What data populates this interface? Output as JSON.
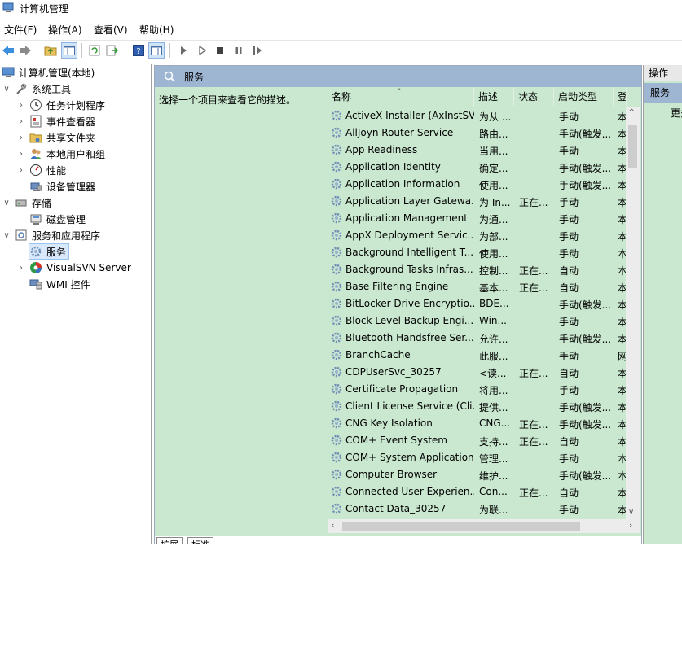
{
  "window": {
    "title": "计算机管理"
  },
  "menu": [
    "文件(F)",
    "操作(A)",
    "查看(V)",
    "帮助(H)"
  ],
  "tree": {
    "root": "计算机管理(本地)",
    "system_tools": "系统工具",
    "task_scheduler": "任务计划程序",
    "event_viewer": "事件查看器",
    "shared_folders": "共享文件夹",
    "local_users": "本地用户和组",
    "performance": "性能",
    "device_manager": "设备管理器",
    "storage": "存储",
    "disk_management": "磁盘管理",
    "services_apps": "服务和应用程序",
    "services": "服务",
    "visualsvn": "VisualSVN Server",
    "wmi": "WMI 控件"
  },
  "center": {
    "header": "服务",
    "description": "选择一个项目来查看它的描述。",
    "columns": {
      "name": "名称",
      "desc": "描述",
      "status": "状态",
      "startup": "启动类型",
      "logon": "登"
    },
    "rows": [
      {
        "name": "ActiveX Installer (AxInstSV)",
        "desc": "为从 ...",
        "status": "",
        "startup": "手动",
        "logon": "本"
      },
      {
        "name": "AllJoyn Router Service",
        "desc": "路由...",
        "status": "",
        "startup": "手动(触发...",
        "logon": "本"
      },
      {
        "name": "App Readiness",
        "desc": "当用...",
        "status": "",
        "startup": "手动",
        "logon": "本"
      },
      {
        "name": "Application Identity",
        "desc": "确定...",
        "status": "",
        "startup": "手动(触发...",
        "logon": "本"
      },
      {
        "name": "Application Information",
        "desc": "使用...",
        "status": "",
        "startup": "手动(触发...",
        "logon": "本"
      },
      {
        "name": "Application Layer Gatewa...",
        "desc": "为 In...",
        "status": "正在...",
        "startup": "手动",
        "logon": "本"
      },
      {
        "name": "Application Management",
        "desc": "为通...",
        "status": "",
        "startup": "手动",
        "logon": "本"
      },
      {
        "name": "AppX Deployment Servic...",
        "desc": "为部...",
        "status": "",
        "startup": "手动",
        "logon": "本"
      },
      {
        "name": "Background Intelligent T...",
        "desc": "使用...",
        "status": "",
        "startup": "手动",
        "logon": "本"
      },
      {
        "name": "Background Tasks Infras...",
        "desc": "控制...",
        "status": "正在...",
        "startup": "自动",
        "logon": "本"
      },
      {
        "name": "Base Filtering Engine",
        "desc": "基本...",
        "status": "正在...",
        "startup": "自动",
        "logon": "本"
      },
      {
        "name": "BitLocker Drive Encryptio...",
        "desc": "BDE...",
        "status": "",
        "startup": "手动(触发...",
        "logon": "本"
      },
      {
        "name": "Block Level Backup Engi...",
        "desc": "Win...",
        "status": "",
        "startup": "手动",
        "logon": "本"
      },
      {
        "name": "Bluetooth Handsfree Ser...",
        "desc": "允许...",
        "status": "",
        "startup": "手动(触发...",
        "logon": "本"
      },
      {
        "name": "BranchCache",
        "desc": "此服...",
        "status": "",
        "startup": "手动",
        "logon": "网"
      },
      {
        "name": "CDPUserSvc_30257",
        "desc": "<读...",
        "status": "正在...",
        "startup": "自动",
        "logon": "本"
      },
      {
        "name": "Certificate Propagation",
        "desc": "将用...",
        "status": "",
        "startup": "手动",
        "logon": "本"
      },
      {
        "name": "Client License Service (Cli...",
        "desc": "提供...",
        "status": "",
        "startup": "手动(触发...",
        "logon": "本"
      },
      {
        "name": "CNG Key Isolation",
        "desc": "CNG...",
        "status": "正在...",
        "startup": "手动(触发...",
        "logon": "本"
      },
      {
        "name": "COM+ Event System",
        "desc": "支持...",
        "status": "正在...",
        "startup": "自动",
        "logon": "本"
      },
      {
        "name": "COM+ System Application",
        "desc": "管理...",
        "status": "",
        "startup": "手动",
        "logon": "本"
      },
      {
        "name": "Computer Browser",
        "desc": "维护...",
        "status": "",
        "startup": "手动(触发...",
        "logon": "本"
      },
      {
        "name": "Connected User Experien...",
        "desc": "Con...",
        "status": "正在...",
        "startup": "自动",
        "logon": "本"
      },
      {
        "name": "Contact Data_30257",
        "desc": "为联...",
        "status": "",
        "startup": "手动",
        "logon": "本"
      }
    ],
    "tabs": [
      "扩展",
      "标准"
    ]
  },
  "actions": {
    "title": "操作",
    "section": "服务",
    "more": "更多"
  }
}
